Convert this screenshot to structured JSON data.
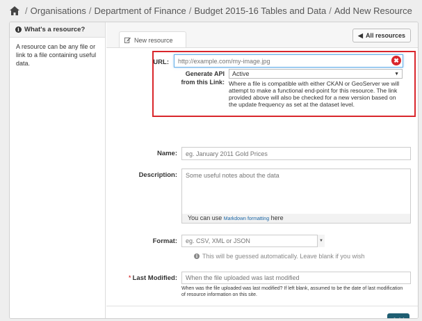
{
  "breadcrumb": {
    "items": [
      "Organisations",
      "Department of Finance",
      "Budget 2015-16 Tables and Data",
      "Add New Resource"
    ],
    "separator": "/"
  },
  "sidebar": {
    "heading": "What's a resource?",
    "text": "A resource can be any file or link to a file containing useful data."
  },
  "tabs": {
    "new_resource": "New resource"
  },
  "toolbar": {
    "all_resources": "All resources"
  },
  "form": {
    "url": {
      "label": "URL:",
      "value": "",
      "placeholder": "http://example.com/my-image.jpg"
    },
    "generate_api": {
      "label_line1": "Generate API",
      "label_line2": "from this Link:",
      "selected": "Active",
      "help": "Where a file is compatible with either CKAN or GeoServer we will attempt to make a functional end-point for this resource. The link provided above will also be checked for a new version based on the update frequency as set at the dataset level."
    },
    "name": {
      "label": "Name:",
      "placeholder": "eg. January 2011 Gold Prices"
    },
    "description": {
      "label": "Description:",
      "placeholder": "Some useful notes about the data",
      "markdown_prefix": "You can use",
      "markdown_link": "Markdown formatting",
      "markdown_suffix": "here"
    },
    "format": {
      "label": "Format:",
      "placeholder": "eg. CSV, XML or JSON",
      "help": "This will be guessed automatically. Leave blank if you wish"
    },
    "last_modified": {
      "required_mark": "*",
      "label": "Last Modified:",
      "placeholder": "When the file uploaded was last modified",
      "help": "When was the file uploaded was last modified? If left blank, assumed to be the date of last modification of resource information on this site."
    },
    "submit": "Add"
  },
  "colors": {
    "accent": "#1f5e72",
    "highlight_border": "#d9262b",
    "link": "#1a66a6"
  }
}
